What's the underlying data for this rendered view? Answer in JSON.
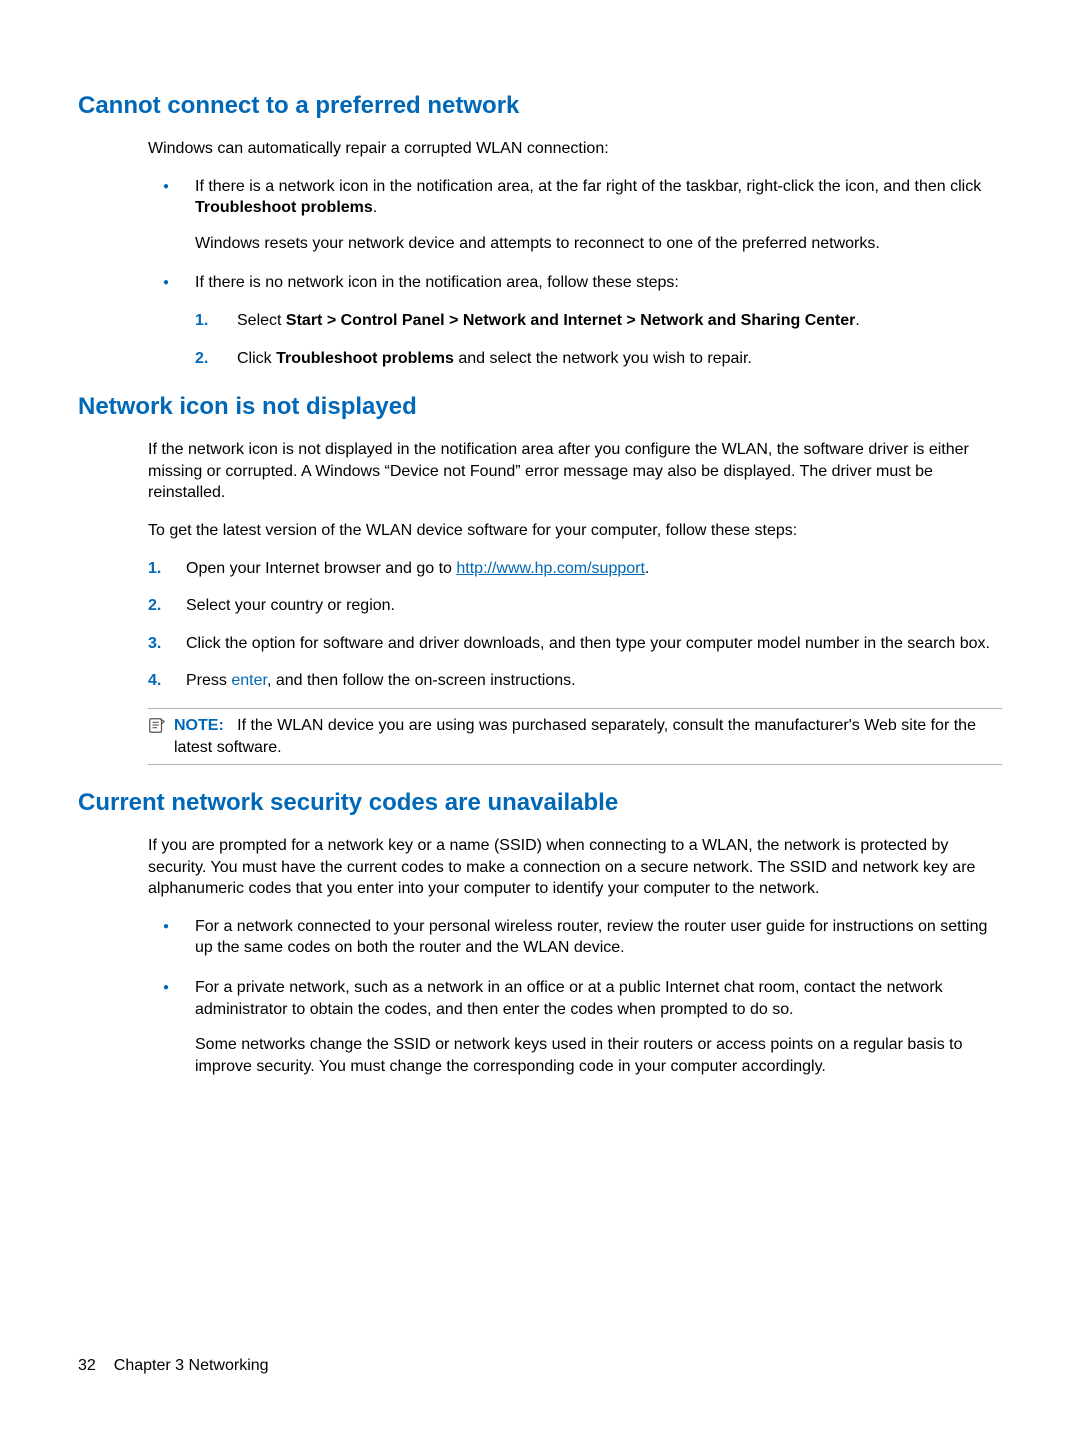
{
  "section1": {
    "heading": "Cannot connect to a preferred network",
    "intro": "Windows can automatically repair a corrupted WLAN connection:",
    "bullet1_a": "If there is a network icon in the notification area, at the far right of the taskbar, right-click the icon, and then click ",
    "bullet1_bold": "Troubleshoot problems",
    "bullet1_b": ".",
    "bullet1_sub": "Windows resets your network device and attempts to reconnect to one of the preferred networks.",
    "bullet2": "If there is no network icon in the notification area, follow these steps:",
    "step1_a": "Select ",
    "step1_bold": "Start > Control Panel > Network and Internet > Network and Sharing Center",
    "step1_b": ".",
    "step2_a": "Click ",
    "step2_bold": "Troubleshoot problems",
    "step2_b": " and select the network you wish to repair.",
    "n1": "1.",
    "n2": "2."
  },
  "section2": {
    "heading": "Network icon is not displayed",
    "p1": "If the network icon is not displayed in the notification area after you configure the WLAN, the software driver is either missing or corrupted. A Windows “Device not Found” error message may also be displayed. The driver must be reinstalled.",
    "p2": "To get the latest version of the WLAN device software for your computer, follow these steps:",
    "step1_a": "Open your Internet browser and go to ",
    "step1_link": "http://www.hp.com/support",
    "step1_b": ".",
    "step2": "Select your country or region.",
    "step3": "Click the option for software and driver downloads, and then type your computer model number in the search box.",
    "step4_a": "Press ",
    "step4_kw": "enter",
    "step4_b": ", and then follow the on-screen instructions.",
    "n1": "1.",
    "n2": "2.",
    "n3": "3.",
    "n4": "4.",
    "note_label": "NOTE:",
    "note_text": "If the WLAN device you are using was purchased separately, consult the manufacturer's Web site for the latest software."
  },
  "section3": {
    "heading": "Current network security codes are unavailable",
    "p1": "If you are prompted for a network key or a name (SSID) when connecting to a WLAN, the network is protected by security. You must have the current codes to make a connection on a secure network. The SSID and network key are alphanumeric codes that you enter into your computer to identify your computer to the network.",
    "bullet1": "For a network connected to your personal wireless router, review the router user guide for instructions on setting up the same codes on both the router and the WLAN device.",
    "bullet2": "For a private network, such as a network in an office or at a public Internet chat room, contact the network administrator to obtain the codes, and then enter the codes when prompted to do so.",
    "bullet2_sub": "Some networks change the SSID or network keys used in their routers or access points on a regular basis to improve security. You must change the corresponding code in your computer accordingly."
  },
  "footer": {
    "pagenum": "32",
    "chapter": "Chapter 3   Networking"
  }
}
